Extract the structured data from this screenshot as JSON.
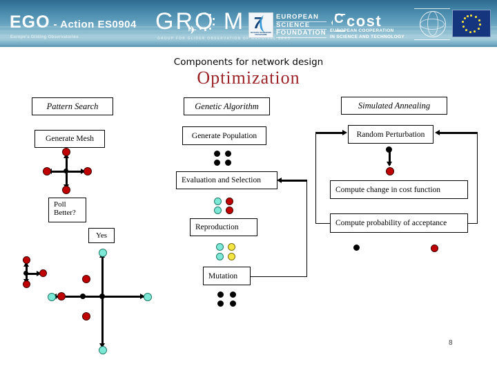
{
  "slide": {
    "subtitle": "Components for network design",
    "title": "Optimization",
    "page_number": "8",
    "title_color": "#9b2226"
  },
  "banner": {
    "ego_title": "EGO",
    "ego_action": "- Action ES0904",
    "ego_tagline": "Europe's Gliding Observatories",
    "groom_title": "GRO    M",
    "groom_subtitle": "GROUP FOR GLIDER OBSERVATION OF MARGINAL SEAS",
    "fp7_number": "7",
    "fp7_caption": "SEVENTH FRAMEWORK PROGRAMME",
    "esf_lines": [
      "EUROPEAN",
      "SCIENCE",
      "FOUNDATION"
    ],
    "cost_letter": "C",
    "cost_word": "cost",
    "cost_sub_line1": "EUROPEAN COOPERATION",
    "cost_sub_line2": "IN SCIENCE AND TECHNOLOGY"
  },
  "columns": {
    "pattern_search": {
      "header": "Pattern Search",
      "boxes": [
        {
          "label": "Generate Mesh"
        },
        {
          "label": "Poll\nBetter?"
        },
        {
          "label": "Yes"
        }
      ],
      "poll_line1": "Poll",
      "poll_line2": "Better?",
      "yes_label": "Yes"
    },
    "genetic_algorithm": {
      "header": "Genetic Algorithm",
      "boxes": [
        {
          "label": "Generate Population"
        },
        {
          "label": "Evaluation and Selection"
        },
        {
          "label": "Reproduction"
        },
        {
          "label": "Mutation"
        }
      ]
    },
    "simulated_annealing": {
      "header": "Simulated Annealing",
      "boxes": [
        {
          "label": "Random Perturbation"
        },
        {
          "label": "Compute change in cost function"
        },
        {
          "label": "Compute probability of acceptance"
        }
      ]
    }
  },
  "colors": {
    "red_dot": "#c00000",
    "black_dot": "#000000",
    "teal_dot": "#7ce8d5",
    "yellow_dot": "#f5e642",
    "banner_blue": "#3b7ca0",
    "eu_blue": "#15357e"
  }
}
